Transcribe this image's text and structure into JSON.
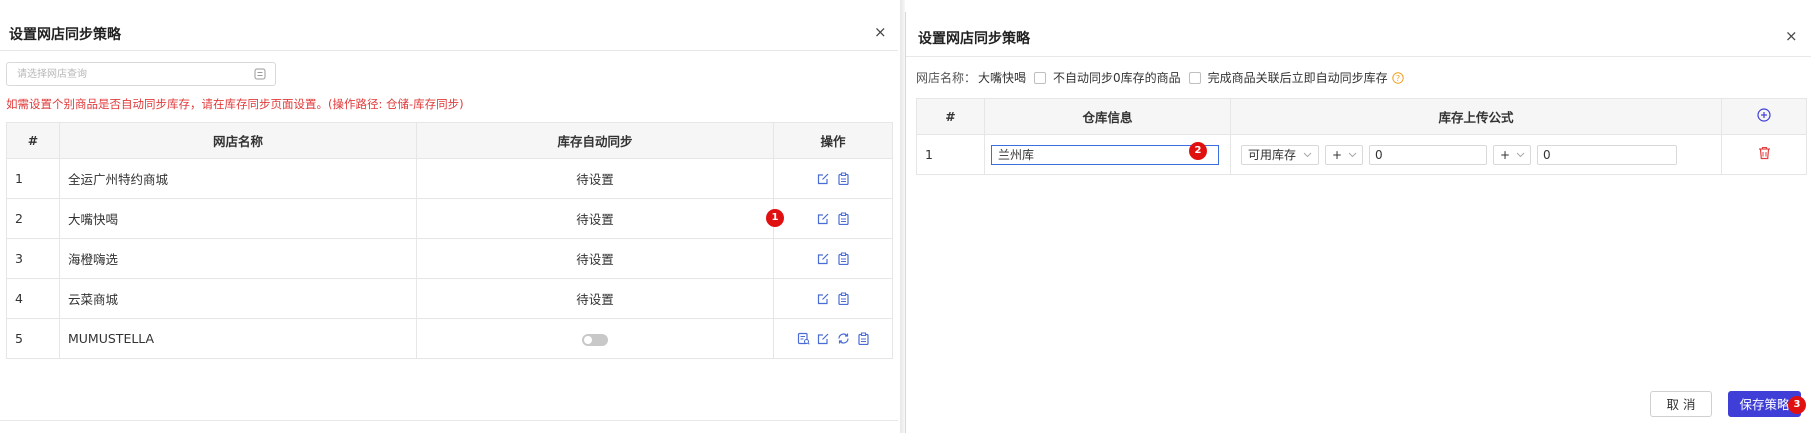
{
  "left_dialog": {
    "title": "设置网店同步策略",
    "close_label": "×",
    "search": {
      "placeholder": "请选择网店查询",
      "value": ""
    },
    "hint": "如需设置个别商品是否自动同步库存，请在库存同步页面设置。(操作路径: 仓储-库存同步)",
    "table": {
      "headers": [
        "#",
        "网店名称",
        "库存自动同步",
        "操作"
      ],
      "rows": [
        {
          "index": "1",
          "name": "全运广州特约商城",
          "sync": "待设置"
        },
        {
          "index": "2",
          "name": "大嘴快喝",
          "sync": "待设置"
        },
        {
          "index": "3",
          "name": "海橙嗨选",
          "sync": "待设置"
        },
        {
          "index": "4",
          "name": "云菜商城",
          "sync": "待设置"
        },
        {
          "index": "5",
          "name": "MUMUSTELLA",
          "sync": "",
          "sync_toggle_on": false
        }
      ]
    },
    "step_badge": "1"
  },
  "right_dialog": {
    "title": "设置网店同步策略",
    "close_label": "×",
    "store_label": "网店名称：",
    "store_name": "大嘴快喝",
    "checkbox1_label": "不自动同步0库存的商品",
    "checkbox2_label": "完成商品关联后立即自动同步库存",
    "table": {
      "headers": [
        "#",
        "仓库信息",
        "库存上传公式"
      ],
      "rows": [
        {
          "index": "1",
          "warehouse": "兰州库",
          "stock_type": "可用库存",
          "op1": "+",
          "val1": "0",
          "op2": "+",
          "val2": "0"
        }
      ]
    },
    "step_badge_2": "2",
    "step_badge_3": "3",
    "cancel_label": "取 消",
    "save_label": "保存策略"
  },
  "colors": {
    "accent": "#3f3fd8",
    "hint_red": "#e03a3a",
    "badge_red": "#e01010",
    "icon_blue": "#4a6cd4",
    "delete_red": "#e04040"
  }
}
